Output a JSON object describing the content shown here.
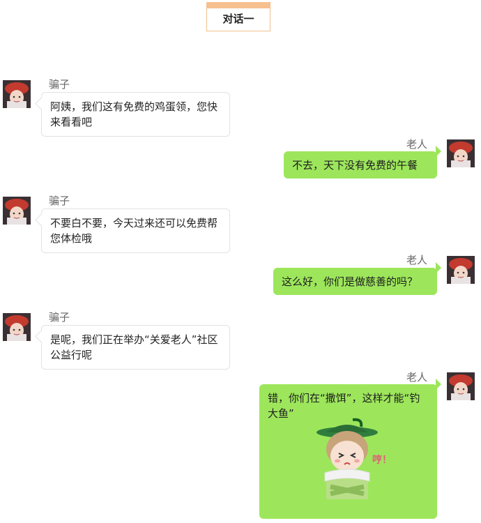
{
  "header": {
    "title": "对话一"
  },
  "messages": [
    {
      "speaker": "骗子",
      "text": "阿姨，我们这有免费的鸡蛋领，您快来看看吧"
    },
    {
      "speaker": "老人",
      "text": "不去，天下没有免费的午餐"
    },
    {
      "speaker": "骗子",
      "text": "不要白不要，今天过来还可以免费帮您体检哦"
    },
    {
      "speaker": "老人",
      "text": "这么好，你们是做慈善的吗？"
    },
    {
      "speaker": "骗子",
      "text": "是呢，我们正在举办“关爱老人”社区公益行呢"
    },
    {
      "speaker": "老人",
      "text": "错，你们在“撒饵”，这样才能“钓大鱼”",
      "sticker": {
        "icon": "cartoon-old-woman-sticker",
        "caption": "哼！"
      }
    }
  ],
  "colors": {
    "accent": "#f6c08f",
    "right_bubble": "#9de65c",
    "left_bubble_border": "#e2e2e2"
  }
}
